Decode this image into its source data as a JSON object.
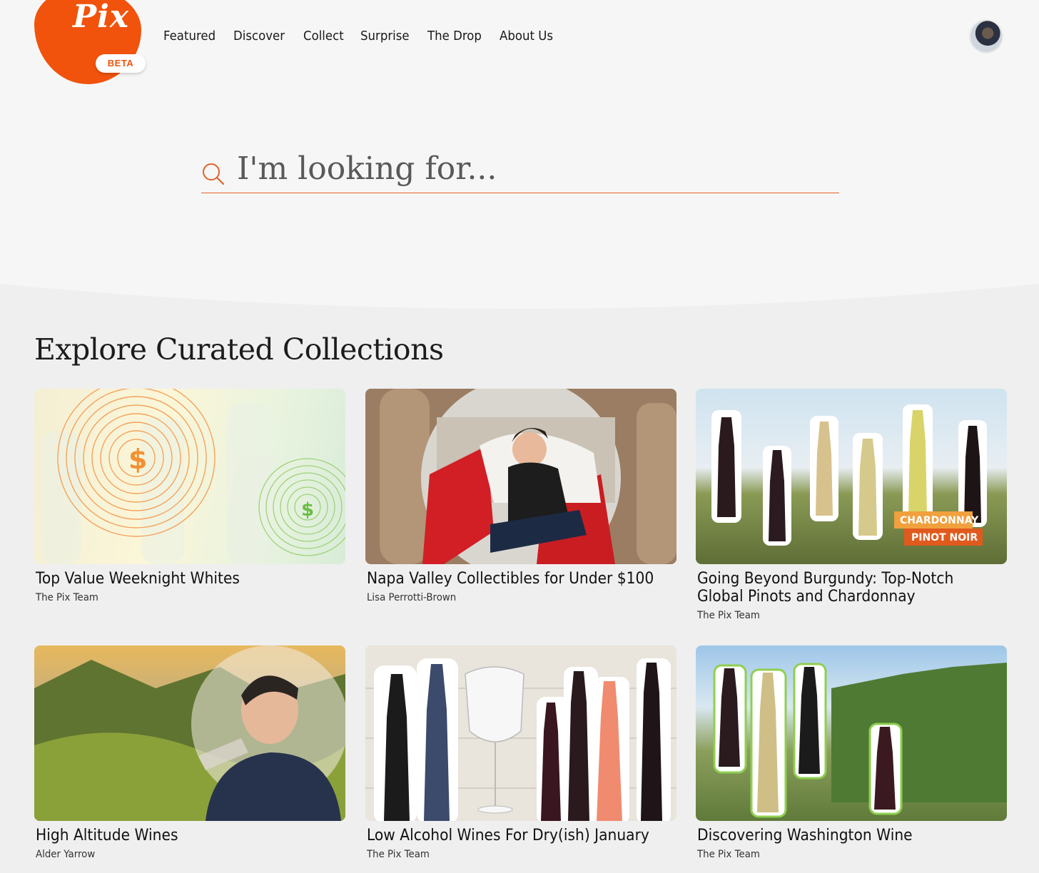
{
  "brand": {
    "logo_text": "Pix",
    "badge": "BETA",
    "accent": "#f1530c"
  },
  "nav": [
    "Featured",
    "Discover",
    "Collect",
    "Surprise",
    "The Drop",
    "About Us"
  ],
  "search": {
    "placeholder": "I'm looking for..."
  },
  "section": {
    "title": "Explore Curated Collections"
  },
  "collections": [
    {
      "title": "Top Value Weeknight Whites",
      "author": "The Pix Team",
      "image": "targets-on-white-wine-bottles"
    },
    {
      "title": "Napa Valley Collectibles for Under $100",
      "author": "Lisa Perrotti-Brown",
      "image": "woman-with-wine-glass-portrait"
    },
    {
      "title": "Going Beyond Burgundy: Top-Notch Global Pinots and Chardonnay",
      "author": "The Pix Team",
      "image": "bottles-over-vineyard-with-signpost",
      "sign_labels": [
        "CHARDONNAY",
        "PINOT NOIR"
      ]
    },
    {
      "title": "High Altitude Wines",
      "author": "Alder Yarrow",
      "image": "man-tasting-wine-mountain-vineyard"
    },
    {
      "title": "Low Alcohol Wines For Dry(ish) January",
      "author": "The Pix Team",
      "image": "bottles-and-empty-glass-on-wood"
    },
    {
      "title": "Discovering Washington Wine",
      "author": "The Pix Team",
      "image": "bottles-over-washington-map"
    }
  ]
}
